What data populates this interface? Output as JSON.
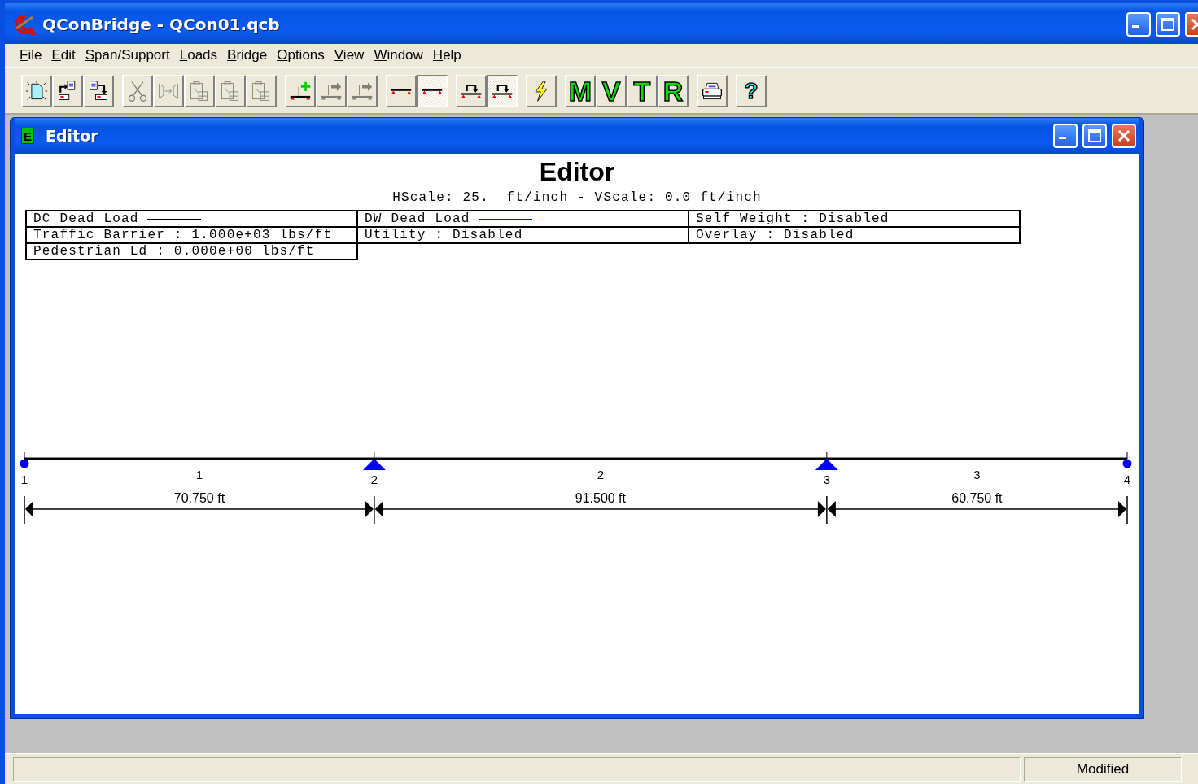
{
  "window": {
    "title": "QConBridge - QCon01.qcb"
  },
  "menu": [
    {
      "label": "File"
    },
    {
      "label": "Edit"
    },
    {
      "label": "Span/Support"
    },
    {
      "label": "Loads"
    },
    {
      "label": "Bridge"
    },
    {
      "label": "Options"
    },
    {
      "label": "View"
    },
    {
      "label": "Window"
    },
    {
      "label": "Help"
    }
  ],
  "toolbar": {
    "groups": [
      {
        "buttons": [
          {
            "kind": "new",
            "disabled": false,
            "pressed": false
          },
          {
            "kind": "export",
            "disabled": false,
            "pressed": false
          },
          {
            "kind": "import",
            "disabled": false,
            "pressed": false
          }
        ]
      },
      {
        "buttons": [
          {
            "kind": "cut",
            "disabled": true,
            "pressed": false
          },
          {
            "kind": "mirror",
            "disabled": true,
            "pressed": false
          },
          {
            "kind": "paste",
            "disabled": true,
            "pressed": false
          },
          {
            "kind": "paste",
            "disabled": true,
            "pressed": false
          },
          {
            "kind": "paste",
            "disabled": true,
            "pressed": false
          }
        ]
      },
      {
        "buttons": [
          {
            "kind": "addspan",
            "disabled": false,
            "pressed": false
          },
          {
            "kind": "insert",
            "disabled": true,
            "pressed": false
          },
          {
            "kind": "insert",
            "disabled": true,
            "pressed": false
          }
        ]
      },
      {
        "buttons": [
          {
            "kind": "beam",
            "disabled": false,
            "pressed": false
          },
          {
            "kind": "beam",
            "disabled": false,
            "pressed": true
          }
        ]
      },
      {
        "buttons": [
          {
            "kind": "rotate",
            "disabled": false,
            "pressed": false
          },
          {
            "kind": "rotate",
            "disabled": false,
            "pressed": true
          }
        ]
      },
      {
        "buttons": [
          {
            "kind": "analyze",
            "disabled": false,
            "pressed": false
          }
        ]
      },
      {
        "buttons": [
          {
            "kind": "letter",
            "label": "M",
            "disabled": false,
            "pressed": false
          },
          {
            "kind": "letter",
            "label": "V",
            "disabled": false,
            "pressed": false
          },
          {
            "kind": "letter",
            "label": "T",
            "disabled": false,
            "pressed": false
          },
          {
            "kind": "letter",
            "label": "R",
            "disabled": false,
            "pressed": false
          }
        ]
      },
      {
        "buttons": [
          {
            "kind": "print",
            "disabled": false,
            "pressed": false
          }
        ]
      },
      {
        "buttons": [
          {
            "kind": "help",
            "label": "?",
            "disabled": false,
            "pressed": false
          }
        ]
      }
    ]
  },
  "editor": {
    "title": "Editor",
    "icon_letter": "E",
    "heading": "Editor",
    "scale": "HScale: 25.  ft/inch - VScale: 0.0 ft/inch",
    "legend": {
      "rows": [
        [
          {
            "text": "DC Dead Load",
            "color": "#000000"
          },
          {
            "text": "DW Dead Load",
            "color": "#0000ff"
          },
          {
            "text": "Self Weight : Disabled"
          }
        ],
        [
          {
            "text": "Traffic Barrier : 1.000e+03 lbs/ft"
          },
          {
            "text": "Utility : Disabled"
          },
          {
            "text": "Overlay : Disabled"
          }
        ],
        [
          {
            "text": "Pedestrian Ld : 0.000e+00 lbs/ft"
          }
        ]
      ]
    },
    "supports": [
      {
        "label": "1",
        "kind": "dot"
      },
      {
        "label": "2",
        "kind": "triangle"
      },
      {
        "label": "3",
        "kind": "triangle"
      },
      {
        "label": "4",
        "kind": "dot"
      }
    ],
    "spans": [
      {
        "label": "1",
        "length": "70.750 ft"
      },
      {
        "label": "2",
        "length": "91.500 ft"
      },
      {
        "label": "3",
        "length": "60.750 ft"
      }
    ]
  },
  "status_bar": {
    "status": "Modified"
  }
}
